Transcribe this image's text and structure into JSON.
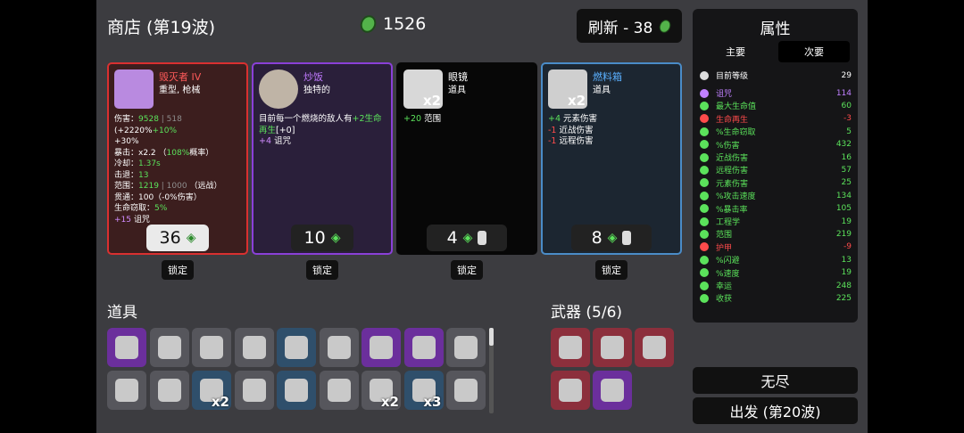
{
  "shop": {
    "title": "商店 (第19波)",
    "materials": "1526",
    "refresh_label": "刷新 - 38"
  },
  "cards": [
    {
      "name": "毁灭者 IV",
      "type": "重型, 枪械",
      "price": "36",
      "lock": "锁定",
      "icon": "minigun-icon"
    },
    {
      "name": "炒饭",
      "type": "独特的",
      "price": "10",
      "lock": "锁定",
      "icon": "fried-rice-icon"
    },
    {
      "name": "眼镜",
      "type": "道具",
      "price": "4",
      "lock": "锁定",
      "icon": "glasses-icon",
      "count": "x2"
    },
    {
      "name": "燃料箱",
      "type": "道具",
      "price": "8",
      "lock": "锁定",
      "icon": "fuel-tank-icon",
      "count": "x2"
    }
  ],
  "card_desc": {
    "c0": {
      "l1a": "伤害：",
      "l1b": "9528",
      "l1c": " | 518 ",
      "l1d": "(+2220%",
      "l1e": "+10%",
      "l2": "+30%",
      "l3a": "暴击：",
      "l3b": "x2.2 （",
      "l3c": "108%",
      "l3d": "概率）",
      "l4a": "冷却：",
      "l4b": "1.37s",
      "l5a": "击退：",
      "l5b": "13",
      "l6a": "范围：",
      "l6b": "1219",
      "l6c": " | 1000 ",
      "l6d": "（远战）",
      "l7": "贯通：100（-0%伤害）",
      "l8a": "生命窃取：",
      "l8b": "5%",
      "l9a": "+15",
      "l9b": " 诅咒"
    },
    "c1": {
      "l1": "目前每一个燃烧的敌人有",
      "l1b": "+2生命再生",
      "l1c": "[+0]",
      "l2a": "+4",
      "l2b": " 诅咒"
    },
    "c2": {
      "l1a": "+20",
      "l1b": " 范围"
    },
    "c3": {
      "l1a": "+4",
      "l1b": " 元素伤害",
      "l2a": "-1",
      "l2b": " 近战伤害",
      "l3a": "-1",
      "l3b": " 远程伤害"
    }
  },
  "items": {
    "title": "道具",
    "slots": [
      {
        "icon": "fuel-tank-icon",
        "bg": "#6b2f9c"
      },
      {
        "icon": "robot-arm-icon",
        "bg": "#56565c"
      },
      {
        "icon": "panda-icon",
        "bg": "#56565c"
      },
      {
        "icon": "egg-face-icon",
        "bg": "#56565c"
      },
      {
        "icon": "shark-fin-icon",
        "bg": "#2f4f6b"
      },
      {
        "icon": "ghost-icon",
        "bg": "#56565c"
      },
      {
        "icon": "torch-icon",
        "bg": "#6b2f9c"
      },
      {
        "icon": "hammer-icon",
        "bg": "#6b2f9c"
      },
      {
        "icon": "duck-icon",
        "bg": "#56565c"
      },
      {
        "icon": "anvil-icon",
        "bg": "#56565c"
      },
      {
        "icon": "clover-icon",
        "bg": "#56565c"
      },
      {
        "icon": "scarf-icon",
        "bg": "#2f4f6b",
        "count": "x2"
      },
      {
        "icon": "potato-icon",
        "bg": "#56565c"
      },
      {
        "icon": "cake-icon",
        "bg": "#2f4f6b"
      },
      {
        "icon": "cash-icon",
        "bg": "#56565c"
      },
      {
        "icon": "bug-icon",
        "bg": "#56565c",
        "count": "x2"
      },
      {
        "icon": "turret-icon",
        "bg": "#2f4f6b",
        "count": "x3"
      },
      {
        "icon": "ghost-icon",
        "bg": "#56565c"
      }
    ]
  },
  "weapons": {
    "title": "武器 (5/6)",
    "slots": [
      {
        "icon": "gun-icon",
        "bg": "#8c2f3c"
      },
      {
        "icon": "gun-icon",
        "bg": "#8c2f3c"
      },
      {
        "icon": "gun-icon",
        "bg": "#8c2f3c"
      },
      {
        "icon": "gun-icon",
        "bg": "#8c2f3c"
      },
      {
        "icon": "cannon-icon",
        "bg": "#6b2f9c"
      }
    ]
  },
  "stats": {
    "title": "属性",
    "tab_main": "主要",
    "tab_sub": "次要",
    "level_label": "目前等级",
    "level_value": "29",
    "rows": [
      {
        "label": "诅咒",
        "value": "114",
        "color": "#c080ff",
        "icon": "curse-icon"
      },
      {
        "label": "最大生命值",
        "value": "60",
        "color": "#5be25b",
        "icon": "heart-icon"
      },
      {
        "label": "生命再生",
        "value": "-3",
        "color": "#ff4b4b",
        "icon": "regen-icon"
      },
      {
        "label": "%生命窃取",
        "value": "5",
        "color": "#5be25b",
        "icon": "lifesteal-icon"
      },
      {
        "label": "%伤害",
        "value": "432",
        "color": "#5be25b",
        "icon": "damage-icon"
      },
      {
        "label": "近战伤害",
        "value": "16",
        "color": "#5be25b",
        "icon": "melee-icon"
      },
      {
        "label": "远程伤害",
        "value": "57",
        "color": "#5be25b",
        "icon": "ranged-icon"
      },
      {
        "label": "元素伤害",
        "value": "25",
        "color": "#5be25b",
        "icon": "elemental-icon"
      },
      {
        "label": "%攻击速度",
        "value": "134",
        "color": "#5be25b",
        "icon": "attack-speed-icon"
      },
      {
        "label": "%暴击率",
        "value": "105",
        "color": "#5be25b",
        "icon": "crit-icon"
      },
      {
        "label": "工程学",
        "value": "19",
        "color": "#5be25b",
        "icon": "engineering-icon"
      },
      {
        "label": "范围",
        "value": "219",
        "color": "#5be25b",
        "icon": "range-icon"
      },
      {
        "label": "护甲",
        "value": "-9",
        "color": "#ff4b4b",
        "icon": "armor-icon"
      },
      {
        "label": "%闪避",
        "value": "13",
        "color": "#5be25b",
        "icon": "dodge-icon"
      },
      {
        "label": "%速度",
        "value": "19",
        "color": "#5be25b",
        "icon": "speed-icon"
      },
      {
        "label": "幸运",
        "value": "248",
        "color": "#5be25b",
        "icon": "luck-icon"
      },
      {
        "label": "收获",
        "value": "225",
        "color": "#5be25b",
        "icon": "harvest-icon"
      }
    ]
  },
  "buttons": {
    "endless": "无尽",
    "go": "出发 (第20波)"
  }
}
